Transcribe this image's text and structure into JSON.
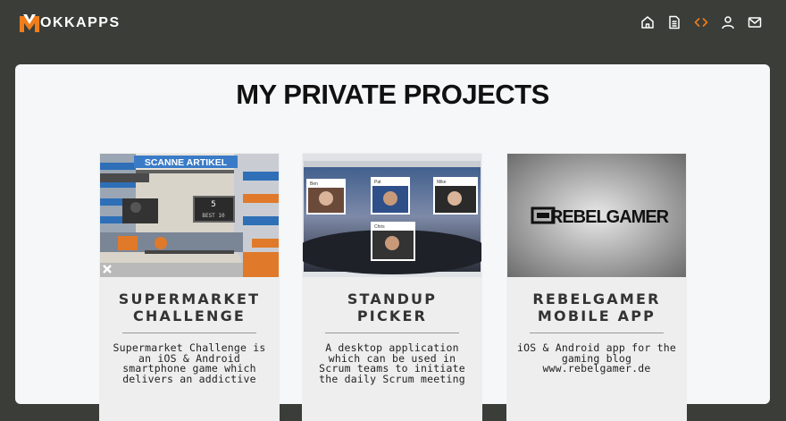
{
  "header": {
    "logo_letter": "M",
    "logo_text": "OKKAPPS",
    "nav": [
      {
        "icon": "home-icon",
        "label": "Home"
      },
      {
        "icon": "document-icon",
        "label": "Documents"
      },
      {
        "icon": "code-icon",
        "label": "Code",
        "active": true
      },
      {
        "icon": "user-icon",
        "label": "User"
      },
      {
        "icon": "mail-icon",
        "label": "Mail"
      }
    ],
    "accent_color": "#f07d1a"
  },
  "main": {
    "title": "MY PRIVATE PROJECTS",
    "projects": [
      {
        "title_line1": "SUPERMARKET",
        "title_line2": "CHALLENGE",
        "description": "Supermarket Challenge is an iOS & Android smartphone game which delivers an addictive",
        "thumb_banner": "SCANNE ARTIKEL",
        "thumb_score": "5",
        "thumb_best": "BEST 10"
      },
      {
        "title_line1": "STANDUP",
        "title_line2": "PICKER",
        "description": "A desktop application which can be used in Scrum teams to initiate the daily Scrum meeting",
        "thumb_names": [
          "Ben",
          "Pat",
          "Mike",
          "Chris"
        ]
      },
      {
        "title_line1": "REBELGAMER",
        "title_line2": "MOBILE APP",
        "description": "iOS & Android app for the gaming blog www.rebelgamer.de",
        "thumb_logo": "REBELGAMER"
      }
    ]
  }
}
